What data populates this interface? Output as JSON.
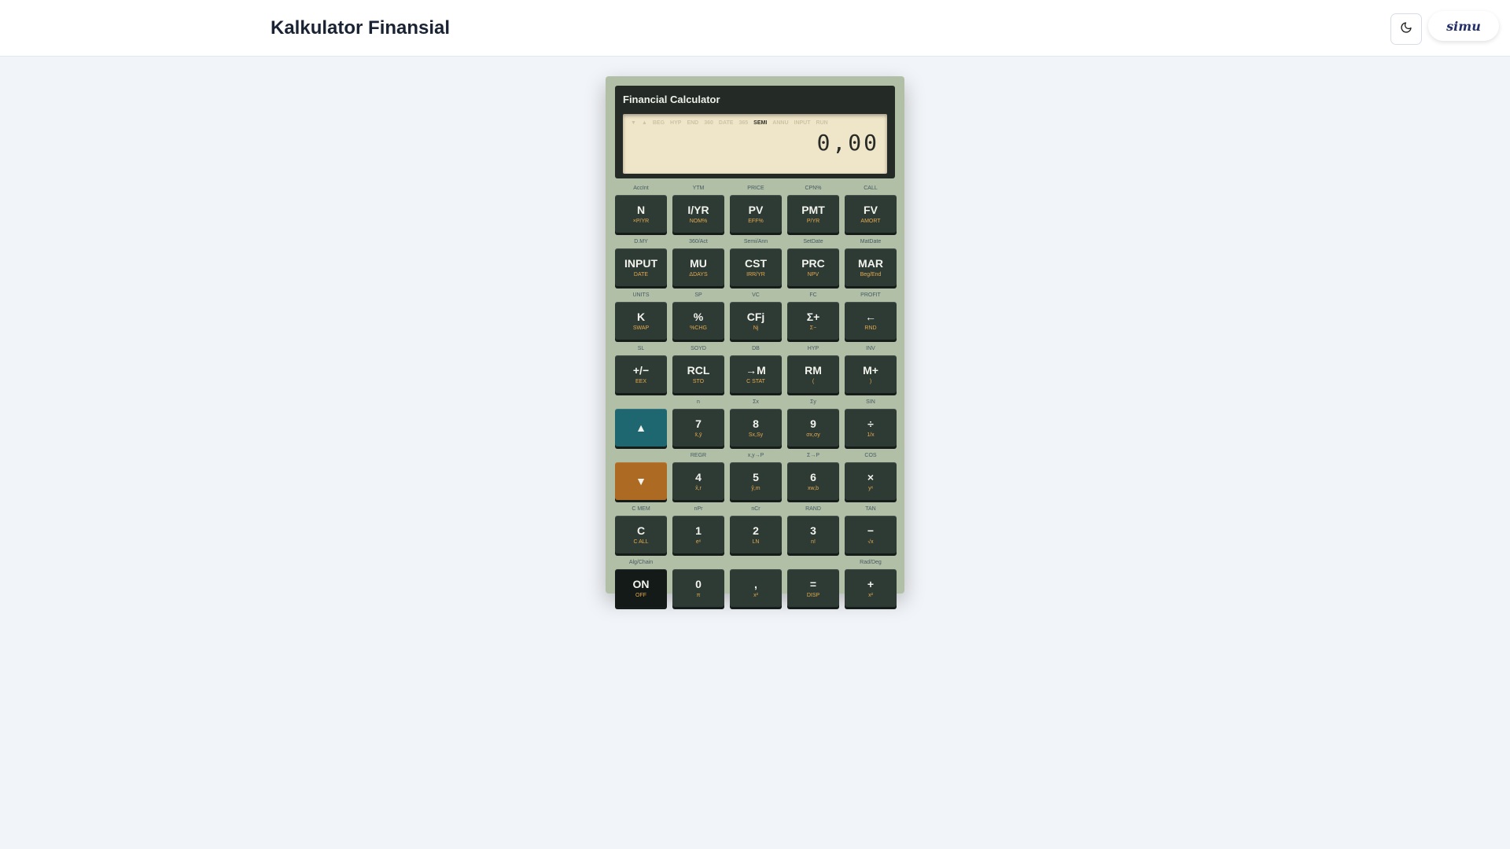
{
  "header": {
    "title": "Kalkulator Finansial",
    "theme_icon": "moon-icon",
    "brand_logo": "simu"
  },
  "calculator": {
    "title": "Financial Calculator",
    "indicators": [
      {
        "label": "▼",
        "on": false
      },
      {
        "label": "▲",
        "on": false
      },
      {
        "label": "BEG",
        "on": false
      },
      {
        "label": "HYP",
        "on": false
      },
      {
        "label": "END",
        "on": false
      },
      {
        "label": "360",
        "on": false
      },
      {
        "label": "DATE",
        "on": false
      },
      {
        "label": "365",
        "on": false
      },
      {
        "label": "SEMI",
        "on": true
      },
      {
        "label": "ANNU",
        "on": false
      },
      {
        "label": "INPUT",
        "on": false
      },
      {
        "label": "RUN",
        "on": false
      }
    ],
    "display_value": "0,00",
    "rows": [
      [
        {
          "top": "AccInt",
          "main": "N",
          "sub": "×P/YR"
        },
        {
          "top": "YTM",
          "main": "I/YR",
          "sub": "NOM%"
        },
        {
          "top": "PRICE",
          "main": "PV",
          "sub": "EFF%"
        },
        {
          "top": "CPN%",
          "main": "PMT",
          "sub": "P/YR"
        },
        {
          "top": "CALL",
          "main": "FV",
          "sub": "AMORT"
        }
      ],
      [
        {
          "top": "D.MY",
          "main": "INPUT",
          "sub": "DATE"
        },
        {
          "top": "360/Act",
          "main": "MU",
          "sub": "ΔDAYS"
        },
        {
          "top": "Semi/Ann",
          "main": "CST",
          "sub": "IRR/YR"
        },
        {
          "top": "SetDate",
          "main": "PRC",
          "sub": "NPV"
        },
        {
          "top": "MatDate",
          "main": "MAR",
          "sub": "Beg/End"
        }
      ],
      [
        {
          "top": "UNITS",
          "main": "K",
          "sub": "SWAP"
        },
        {
          "top": "SP",
          "main": "%",
          "sub": "%CHG"
        },
        {
          "top": "VC",
          "main": "CFj",
          "sub": "Nj"
        },
        {
          "top": "FC",
          "main": "Σ+",
          "sub": "Σ−"
        },
        {
          "top": "PROFIT",
          "main": "←",
          "sub": "RND"
        }
      ],
      [
        {
          "top": "SL",
          "main": "+/−",
          "sub": "EEX"
        },
        {
          "top": "SOYD",
          "main": "RCL",
          "sub": "STO"
        },
        {
          "top": "DB",
          "main": "→M",
          "sub": "C STAT"
        },
        {
          "top": "HYP",
          "main": "RM",
          "sub": "("
        },
        {
          "top": "INV",
          "main": "M+",
          "sub": ")"
        }
      ],
      [
        {
          "top": "",
          "main": "▲",
          "sub": "",
          "style": "up"
        },
        {
          "top": "n",
          "main": "7",
          "sub": "x̄,ȳ"
        },
        {
          "top": "Σx",
          "main": "8",
          "sub": "Sx,Sy"
        },
        {
          "top": "Σy",
          "main": "9",
          "sub": "σx,σy"
        },
        {
          "top": "SIN",
          "main": "÷",
          "sub": "1/x"
        }
      ],
      [
        {
          "top": "",
          "main": "▼",
          "sub": "",
          "style": "down"
        },
        {
          "top": "REGR",
          "main": "4",
          "sub": "x̂,r"
        },
        {
          "top": "x,y→P",
          "main": "5",
          "sub": "ŷ,m"
        },
        {
          "top": "Σ→P",
          "main": "6",
          "sub": "xw,b"
        },
        {
          "top": "COS",
          "main": "×",
          "sub": "yˣ"
        }
      ],
      [
        {
          "top": "C MEM",
          "main": "C",
          "sub": "C ALL"
        },
        {
          "top": "nPr",
          "main": "1",
          "sub": "eˣ"
        },
        {
          "top": "nCr",
          "main": "2",
          "sub": "LN"
        },
        {
          "top": "RAND",
          "main": "3",
          "sub": "n!"
        },
        {
          "top": "TAN",
          "main": "−",
          "sub": "√x"
        }
      ],
      [
        {
          "top": "Alg/Chain",
          "main": "ON",
          "sub": "OFF",
          "style": "on"
        },
        {
          "top": "",
          "main": "0",
          "sub": "π"
        },
        {
          "top": "",
          "main": ",",
          "sub": "x²"
        },
        {
          "top": "",
          "main": "=",
          "sub": "DISP"
        },
        {
          "top": "Rad/Deg",
          "main": "+",
          "sub": "x²"
        }
      ]
    ]
  }
}
